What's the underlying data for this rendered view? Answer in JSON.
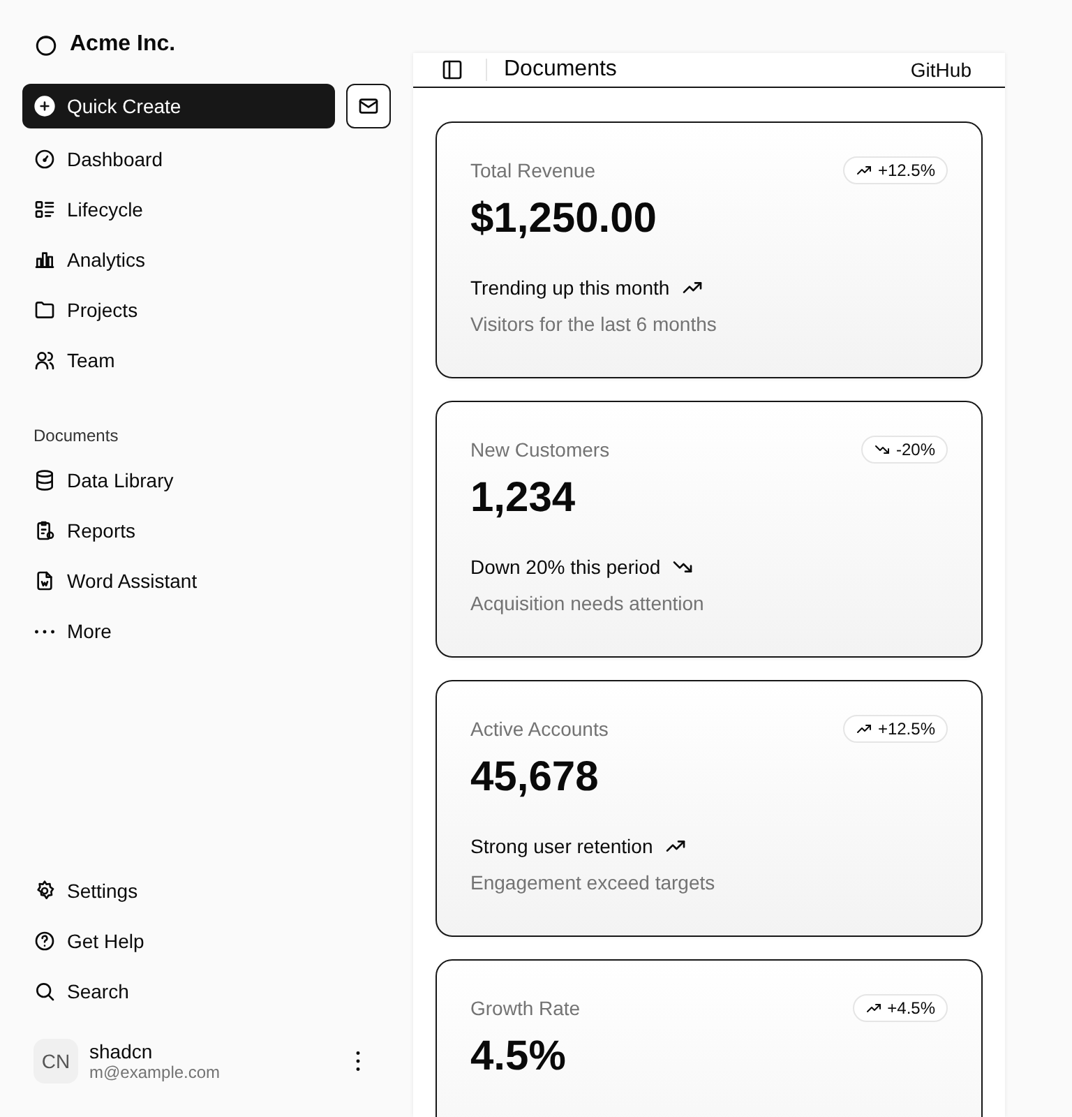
{
  "sidebar": {
    "brand": "Acme Inc.",
    "quick_create": "Quick Create",
    "nav": [
      "Dashboard",
      "Lifecycle",
      "Analytics",
      "Projects",
      "Team"
    ],
    "documents_heading": "Documents",
    "documents": [
      "Data Library",
      "Reports",
      "Word Assistant",
      "More"
    ],
    "secondary": [
      "Settings",
      "Get Help",
      "Search"
    ],
    "user": {
      "initials": "CN",
      "name": "shadcn",
      "email": "m@example.com"
    }
  },
  "header": {
    "title": "Documents",
    "link": "GitHub"
  },
  "cards": [
    {
      "label": "Total Revenue",
      "value": "$1,250.00",
      "badge": "+12.5%",
      "kind": "up",
      "headline": "Trending up this month",
      "footer": "Visitors for the last 6 months"
    },
    {
      "label": "New Customers",
      "value": "1,234",
      "badge": "-20%",
      "kind": "down",
      "headline": "Down 20% this period",
      "footer": "Acquisition needs attention"
    },
    {
      "label": "Active Accounts",
      "value": "45,678",
      "badge": "+12.5%",
      "kind": "up",
      "headline": "Strong user retention",
      "footer": "Engagement exceed targets"
    },
    {
      "label": "Growth Rate",
      "value": "4.5%",
      "badge": "+4.5%",
      "kind": "up"
    }
  ]
}
